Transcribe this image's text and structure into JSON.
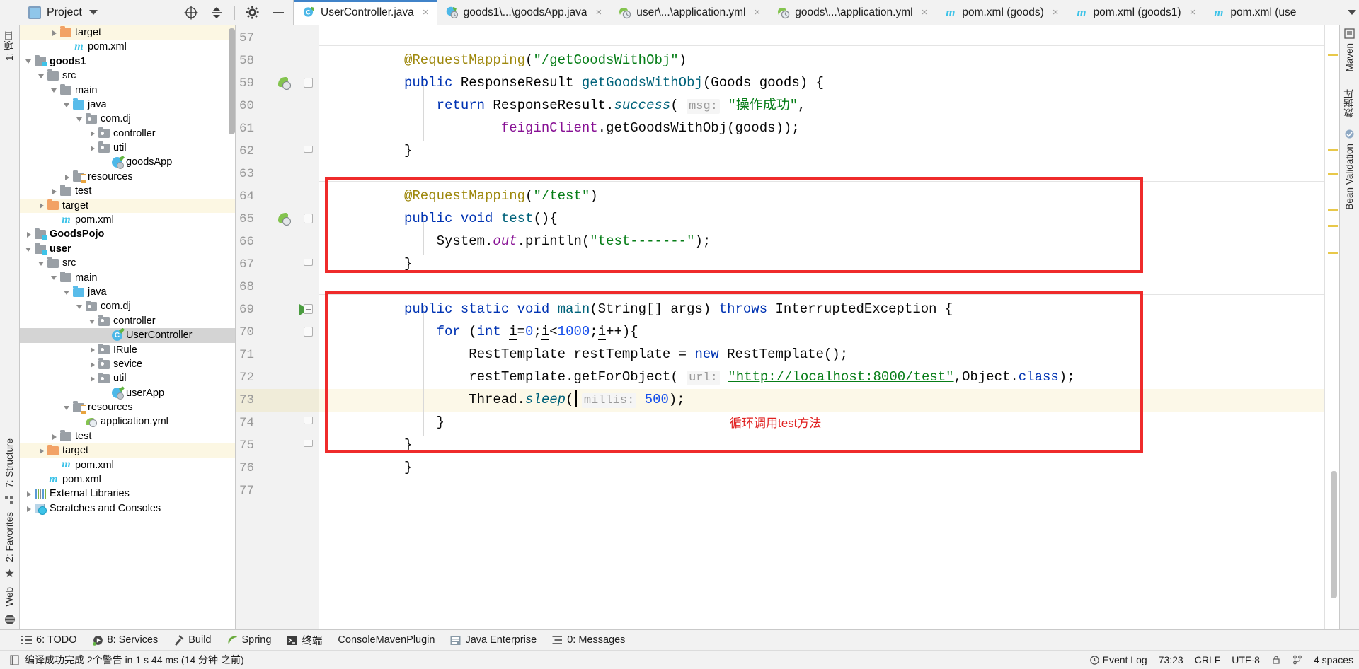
{
  "window": {
    "left_strip_label": "1: 项目",
    "right_strip_labels": [
      "Maven",
      "数据库",
      "Bean Validation"
    ],
    "left_strip_bottom_labels": [
      "7: Structure",
      "2: Favorites",
      "Web"
    ]
  },
  "project_toolbar": {
    "title": "Project",
    "caret_icon": "chevron-down-icon",
    "locate_icon": "crosshair-target-icon",
    "collapse_icon": "collapse-all-icon",
    "settings_icon": "gear-icon",
    "hide_icon": "minimize-icon"
  },
  "tabs": [
    {
      "label": "UserController.java",
      "icon": "java-class-boot-icon",
      "active": true,
      "close": "×"
    },
    {
      "label": "goods1\\...\\goodsApp.java",
      "icon": "spring-boot-class-icon",
      "active": false,
      "close": "×"
    },
    {
      "label": "user\\...\\application.yml",
      "icon": "yml-spring-icon",
      "active": false,
      "close": "×"
    },
    {
      "label": "goods\\...\\application.yml",
      "icon": "yml-spring-icon",
      "active": false,
      "close": "×"
    },
    {
      "label": "pom.xml (goods)",
      "icon": "maven-icon",
      "active": false,
      "close": "×"
    },
    {
      "label": "pom.xml (goods1)",
      "icon": "maven-icon",
      "active": false,
      "close": "×"
    },
    {
      "label": "pom.xml (use",
      "icon": "maven-icon",
      "active": false,
      "close": ""
    }
  ],
  "tabs_overflow_icon": "chevron-down-icon",
  "tree": [
    {
      "label": "target",
      "depth": 3,
      "arrow": "right",
      "icon": "folder-orange",
      "state": "highlight",
      "bold": false
    },
    {
      "label": "pom.xml",
      "depth": 4,
      "arrow": "none",
      "icon": "maven",
      "state": "normal",
      "bold": false
    },
    {
      "label": "goods1",
      "depth": 1,
      "arrow": "down",
      "icon": "folder-module",
      "state": "normal",
      "bold": true
    },
    {
      "label": "src",
      "depth": 2,
      "arrow": "down",
      "icon": "folder-gray",
      "state": "normal",
      "bold": false
    },
    {
      "label": "main",
      "depth": 3,
      "arrow": "down",
      "icon": "folder-gray",
      "state": "normal",
      "bold": false
    },
    {
      "label": "java",
      "depth": 4,
      "arrow": "down",
      "icon": "folder-blue",
      "state": "normal",
      "bold": false
    },
    {
      "label": "com.dj",
      "depth": 5,
      "arrow": "down",
      "icon": "folder-package",
      "state": "normal",
      "bold": false
    },
    {
      "label": "controller",
      "depth": 6,
      "arrow": "right",
      "icon": "folder-package",
      "state": "normal",
      "bold": false
    },
    {
      "label": "util",
      "depth": 6,
      "arrow": "right",
      "icon": "folder-package",
      "state": "normal",
      "bold": false
    },
    {
      "label": "goodsApp",
      "depth": 7,
      "arrow": "none",
      "icon": "spring-boot",
      "state": "normal",
      "bold": false
    },
    {
      "label": "resources",
      "depth": 4,
      "arrow": "right",
      "icon": "folder-res",
      "state": "normal",
      "bold": false
    },
    {
      "label": "test",
      "depth": 3,
      "arrow": "right",
      "icon": "folder-gray",
      "state": "normal",
      "bold": false
    },
    {
      "label": "target",
      "depth": 2,
      "arrow": "right",
      "icon": "folder-orange",
      "state": "highlight",
      "bold": false
    },
    {
      "label": "pom.xml",
      "depth": 3,
      "arrow": "none",
      "icon": "maven",
      "state": "normal",
      "bold": false
    },
    {
      "label": "GoodsPojo",
      "depth": 1,
      "arrow": "right",
      "icon": "folder-module",
      "state": "normal",
      "bold": true
    },
    {
      "label": "user",
      "depth": 1,
      "arrow": "down",
      "icon": "folder-module",
      "state": "normal",
      "bold": true
    },
    {
      "label": "src",
      "depth": 2,
      "arrow": "down",
      "icon": "folder-gray",
      "state": "normal",
      "bold": false
    },
    {
      "label": "main",
      "depth": 3,
      "arrow": "down",
      "icon": "folder-gray",
      "state": "normal",
      "bold": false
    },
    {
      "label": "java",
      "depth": 4,
      "arrow": "down",
      "icon": "folder-blue",
      "state": "normal",
      "bold": false
    },
    {
      "label": "com.dj",
      "depth": 5,
      "arrow": "down",
      "icon": "folder-package",
      "state": "normal",
      "bold": false
    },
    {
      "label": "controller",
      "depth": 6,
      "arrow": "down",
      "icon": "folder-package",
      "state": "normal",
      "bold": false
    },
    {
      "label": "UserController",
      "depth": 7,
      "arrow": "none",
      "icon": "java-class",
      "state": "selected",
      "bold": false
    },
    {
      "label": "IRule",
      "depth": 6,
      "arrow": "right",
      "icon": "folder-package",
      "state": "normal",
      "bold": false
    },
    {
      "label": "sevice",
      "depth": 6,
      "arrow": "right",
      "icon": "folder-package",
      "state": "normal",
      "bold": false
    },
    {
      "label": "util",
      "depth": 6,
      "arrow": "right",
      "icon": "folder-package",
      "state": "normal",
      "bold": false
    },
    {
      "label": "userApp",
      "depth": 7,
      "arrow": "none",
      "icon": "spring-boot",
      "state": "normal",
      "bold": false
    },
    {
      "label": "resources",
      "depth": 4,
      "arrow": "down",
      "icon": "folder-res",
      "state": "normal",
      "bold": false
    },
    {
      "label": "application.yml",
      "depth": 5,
      "arrow": "none",
      "icon": "yml",
      "state": "normal",
      "bold": false
    },
    {
      "label": "test",
      "depth": 3,
      "arrow": "right",
      "icon": "folder-gray",
      "state": "normal",
      "bold": false
    },
    {
      "label": "target",
      "depth": 2,
      "arrow": "right",
      "icon": "folder-orange",
      "state": "highlight",
      "bold": false
    },
    {
      "label": "pom.xml",
      "depth": 3,
      "arrow": "none",
      "icon": "maven",
      "state": "normal",
      "bold": false
    },
    {
      "label": "pom.xml",
      "depth": 2,
      "arrow": "none",
      "icon": "maven",
      "state": "normal",
      "bold": false
    },
    {
      "label": "External Libraries",
      "depth": 1,
      "arrow": "right",
      "icon": "libraries",
      "state": "normal",
      "bold": false
    },
    {
      "label": "Scratches and Consoles",
      "depth": 1,
      "arrow": "right",
      "icon": "scratches",
      "state": "normal",
      "bold": false
    }
  ],
  "editor": {
    "file": "UserController.java",
    "first_line": 57,
    "last_line": 77,
    "line_numbers": [
      57,
      58,
      59,
      60,
      61,
      62,
      63,
      64,
      65,
      66,
      67,
      68,
      69,
      70,
      71,
      72,
      73,
      74,
      75,
      76,
      77
    ],
    "current_line": 73,
    "annotation_note": "循环调用test方法",
    "lines": [
      {
        "n": 57,
        "tokens": []
      },
      {
        "n": 58,
        "tokens": [
          {
            "t": "@RequestMapping",
            "c": "ann"
          },
          {
            "t": "(",
            "c": "pln"
          },
          {
            "t": "\"/getGoodsWithObj\"",
            "c": "str"
          },
          {
            "t": ")",
            "c": "pln"
          }
        ]
      },
      {
        "n": 59,
        "tokens": [
          {
            "t": "public ",
            "c": "kw"
          },
          {
            "t": "ResponseResult ",
            "c": "cls"
          },
          {
            "t": "getGoodsWithObj",
            "c": "fn"
          },
          {
            "t": "(",
            "c": "pln"
          },
          {
            "t": "Goods goods",
            "c": "cls"
          },
          {
            "t": ") {",
            "c": "pln"
          }
        ]
      },
      {
        "n": 60,
        "tokens": [
          {
            "t": "    return ",
            "c": "kw"
          },
          {
            "t": "ResponseResult.",
            "c": "cls"
          },
          {
            "t": "success",
            "c": "smth"
          },
          {
            "t": "( ",
            "c": "pln"
          },
          {
            "t": "msg:",
            "c": "hint"
          },
          {
            "t": " ",
            "c": "pln"
          },
          {
            "t": "\"操作成功\"",
            "c": "str"
          },
          {
            "t": ",",
            "c": "pln"
          }
        ]
      },
      {
        "n": 61,
        "tokens": [
          {
            "t": "            ",
            "c": "pln"
          },
          {
            "t": "feiginClient",
            "c": "fld"
          },
          {
            "t": ".",
            "c": "pln"
          },
          {
            "t": "getGoodsWithObj",
            "c": "pln"
          },
          {
            "t": "(goods));",
            "c": "pln"
          }
        ]
      },
      {
        "n": 62,
        "tokens": [
          {
            "t": "}",
            "c": "pln"
          }
        ]
      },
      {
        "n": 63,
        "tokens": []
      },
      {
        "n": 64,
        "tokens": [
          {
            "t": "@RequestMapping",
            "c": "ann"
          },
          {
            "t": "(",
            "c": "pln"
          },
          {
            "t": "\"/test\"",
            "c": "str"
          },
          {
            "t": ")",
            "c": "pln"
          }
        ]
      },
      {
        "n": 65,
        "tokens": [
          {
            "t": "public void ",
            "c": "kw"
          },
          {
            "t": "test",
            "c": "fn"
          },
          {
            "t": "(){",
            "c": "pln"
          }
        ]
      },
      {
        "n": 66,
        "tokens": [
          {
            "t": "    System.",
            "c": "pln"
          },
          {
            "t": "out",
            "c": "sfld"
          },
          {
            "t": ".println(",
            "c": "pln"
          },
          {
            "t": "\"test-------\"",
            "c": "str"
          },
          {
            "t": ");",
            "c": "pln"
          }
        ]
      },
      {
        "n": 67,
        "tokens": [
          {
            "t": "}",
            "c": "pln"
          }
        ]
      },
      {
        "n": 68,
        "tokens": []
      },
      {
        "n": 69,
        "tokens": [
          {
            "t": "public static void ",
            "c": "kw"
          },
          {
            "t": "main",
            "c": "fn"
          },
          {
            "t": "(String[] args) ",
            "c": "pln"
          },
          {
            "t": "throws ",
            "c": "kw"
          },
          {
            "t": "InterruptedException {",
            "c": "pln"
          }
        ]
      },
      {
        "n": 70,
        "tokens": [
          {
            "t": "    for ",
            "c": "kw"
          },
          {
            "t": "(",
            "c": "pln"
          },
          {
            "t": "int ",
            "c": "kw"
          },
          {
            "t": "i",
            "c": "ulv"
          },
          {
            "t": "=",
            "c": "pln"
          },
          {
            "t": "0",
            "c": "num"
          },
          {
            "t": ";",
            "c": "pln"
          },
          {
            "t": "i",
            "c": "ulv"
          },
          {
            "t": "<",
            "c": "pln"
          },
          {
            "t": "1000",
            "c": "num"
          },
          {
            "t": ";",
            "c": "pln"
          },
          {
            "t": "i",
            "c": "ulv"
          },
          {
            "t": "++){",
            "c": "pln"
          }
        ]
      },
      {
        "n": 71,
        "tokens": [
          {
            "t": "        RestTemplate restTemplate = ",
            "c": "pln"
          },
          {
            "t": "new ",
            "c": "kw"
          },
          {
            "t": "RestTemplate();",
            "c": "pln"
          }
        ]
      },
      {
        "n": 72,
        "tokens": [
          {
            "t": "        restTemplate.getForObject( ",
            "c": "pln"
          },
          {
            "t": "url:",
            "c": "hint"
          },
          {
            "t": " ",
            "c": "pln"
          },
          {
            "t": "\"http://localhost:8000/test\"",
            "c": "lnk"
          },
          {
            "t": ",Object.",
            "c": "pln"
          },
          {
            "t": "class",
            "c": "kw"
          },
          {
            "t": ");",
            "c": "pln"
          }
        ]
      },
      {
        "n": 73,
        "tokens": [
          {
            "t": "        Thread.",
            "c": "pln"
          },
          {
            "t": "sleep",
            "c": "smth"
          },
          {
            "t": "( ",
            "c": "pln"
          },
          {
            "t": "millis:",
            "c": "hint"
          },
          {
            "t": " ",
            "c": "pln"
          },
          {
            "t": "500",
            "c": "num"
          },
          {
            "t": ");",
            "c": "pln"
          }
        ]
      },
      {
        "n": 74,
        "tokens": [
          {
            "t": "    }",
            "c": "pln"
          }
        ]
      },
      {
        "n": 75,
        "tokens": [
          {
            "t": "}",
            "c": "pln"
          }
        ]
      },
      {
        "n": 76,
        "tokens": [
          {
            "t": "}",
            "c": "pln"
          }
        ]
      },
      {
        "n": 77,
        "tokens": []
      }
    ]
  },
  "tool_windows": [
    {
      "label": "6: TODO",
      "underline": "6",
      "icon": "todo-icon"
    },
    {
      "label": "8: Services",
      "underline": "8",
      "icon": "services-icon"
    },
    {
      "label": "Build",
      "underline": "",
      "icon": "build-hammer-icon"
    },
    {
      "label": "Spring",
      "underline": "",
      "icon": "spring-leaf-icon"
    },
    {
      "label": "终端",
      "underline": "",
      "icon": "terminal-icon"
    },
    {
      "label": "ConsoleMavenPlugin",
      "underline": "",
      "icon": "none"
    },
    {
      "label": "Java Enterprise",
      "underline": "",
      "icon": "java-enterprise-icon"
    },
    {
      "label": "0: Messages",
      "underline": "0",
      "icon": "messages-icon"
    }
  ],
  "status": {
    "message": "编译成功完成 2个警告 in 1 s 44 ms (14 分钟 之前)",
    "message_icon": "build-status-icon",
    "caret_position": "73:23",
    "line_separator": "CRLF",
    "encoding": "UTF-8",
    "indent": "4 spaces",
    "event_log": "Event Log",
    "event_log_icon": "bell-icon",
    "lock_icon": "lock-icon",
    "branch_icon": "git-branch-icon"
  },
  "colors": {
    "accent_blue": "#4083c9",
    "red_annotation": "#ef2b2b",
    "highlight_yellow": "#fcf8e8",
    "selection_gray": "#d4d4d4",
    "keyword": "#0033b3",
    "string": "#067d17",
    "annotation": "#9e880d",
    "number": "#1750eb",
    "field": "#871094",
    "method": "#00627a"
  }
}
